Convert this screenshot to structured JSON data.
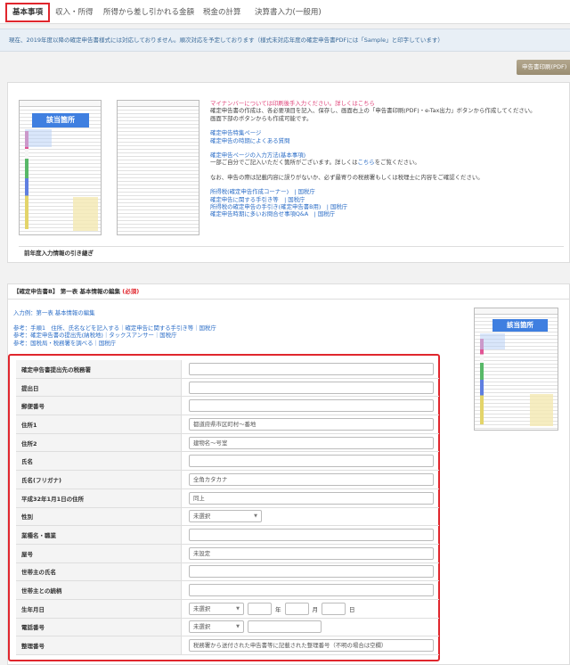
{
  "tabs": [
    "基本事項",
    "収入・所得",
    "所得から差し引かれる金額",
    "税金の計算",
    "決算書入力(一般用)"
  ],
  "notice": "現在、2019年度以降の確定申告書様式には対応しておりません。順次対応を予定しております（様式未対応年度の確定申告書PDFには「Sample」と印字しています）",
  "print_button": "申告書印刷(PDF)",
  "form_image_label": "該当箇所",
  "info": {
    "line1_pink": "マイナンバーについては印刷後手入力ください。詳しくはこちら",
    "line2": "確定申告書の作成は、各必要項目を記入、保存し、画面右上の「申告書印刷(PDF)・e-Tax出力」ボタンから作成してください。",
    "line3": "画面下部のボタンからも作成可能です。",
    "link1": "確定申告特集ページ",
    "link2": "確定申告の時期によくある質問",
    "link3": "確定申告ページの入力方法(基本事項)",
    "line4_pre": "一部ご自分でご記入いただく箇所がございます。詳しくは",
    "line4_link": "こちら",
    "line4_post": "をご覧ください。",
    "line5": "なお、申告の際は記載内容に誤りがないか、必ず最寄りの税務署もしくは税理士に内容をご確認ください。",
    "links": [
      "所得税(確定申告作成コーナー)　| 国税庁",
      "確定申告に関する手引き等　| 国税庁",
      "所得税の確定申告の手引き(確定申告書B用)　| 国税庁",
      "確定申告時期に多いお問合せ事項Q&A　| 国税庁"
    ]
  },
  "prev_year_bar": "前年度入力情報の引き継ぎ",
  "section": {
    "title": "【確定申告書B】 第一表 基本情報の編集",
    "required": "(必須)",
    "example": "入力例：第一表 基本情報の編集",
    "ref1": "参考：手順1　住所、氏名などを記入する｜確定申告に関する手引き等｜国税庁",
    "ref2": "参考：確定申告書の提出先(納税地)｜タックスアンサー｜国税庁",
    "ref3": "参考：国税局・税務署を調べる｜国税庁"
  },
  "form": {
    "rows": [
      {
        "label": "確定申告書提出先の税務署",
        "value": ""
      },
      {
        "label": "提出日",
        "value": ""
      },
      {
        "label": "郵便番号",
        "value": ""
      },
      {
        "label": "住所1",
        "value": "都道府県市区町村〜番地"
      },
      {
        "label": "住所2",
        "value": "建物名〜号室"
      },
      {
        "label": "氏名",
        "value": ""
      },
      {
        "label": "氏名(フリガナ)",
        "value": "全角カタカナ"
      },
      {
        "label": "平成32年1月1日の住所",
        "value": "同上"
      },
      {
        "label": "性別",
        "select": "未選択"
      },
      {
        "label": "業種名・職業",
        "value": ""
      },
      {
        "label": "屋号",
        "value": "未設定"
      },
      {
        "label": "世帯主の氏名",
        "value": ""
      },
      {
        "label": "世帯主との続柄",
        "value": ""
      },
      {
        "label": "生年月日",
        "select": "未選択",
        "units": [
          "年",
          "月",
          "日"
        ]
      },
      {
        "label": "電話番号",
        "select": "未選択"
      },
      {
        "label": "整理番号",
        "value": "税務署から送付された申告書等に記載された整理番号（不明の場合は空欄）"
      }
    ]
  }
}
